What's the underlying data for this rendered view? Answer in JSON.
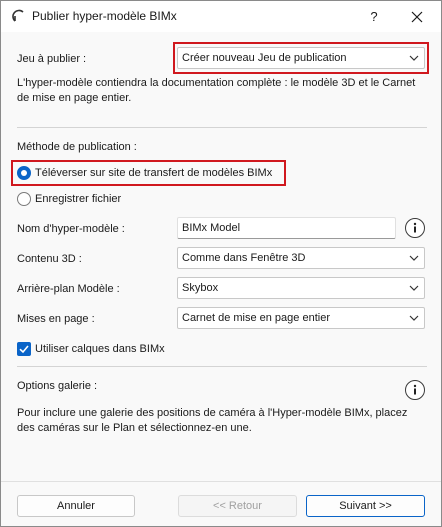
{
  "window": {
    "title": "Publier hyper-modèle BIMx",
    "help_label": "?",
    "close_label": "✕"
  },
  "publish_set": {
    "label": "Jeu à publier :",
    "value": "Créer nouveau Jeu de publication",
    "description": "L'hyper-modèle contiendra la documentation complète : le modèle 3D et le Carnet de mise en page entier."
  },
  "method": {
    "label": "Méthode de publication :",
    "options": [
      {
        "label": "Téléverser sur site de transfert de modèles BIMx",
        "selected": true
      },
      {
        "label": "Enregistrer fichier",
        "selected": false
      }
    ]
  },
  "fields": {
    "model_name_label": "Nom d'hyper-modèle :",
    "model_name_value": "BIMx Model",
    "content3d_label": "Contenu 3D :",
    "content3d_value": "Comme dans Fenêtre 3D",
    "background_label": "Arrière-plan Modèle :",
    "background_value": "Skybox",
    "layouts_label": "Mises en page :",
    "layouts_value": "Carnet de mise en page entier",
    "layers_checkbox_label": "Utiliser calques dans BIMx",
    "layers_checked": true
  },
  "gallery": {
    "label": "Options galerie :",
    "description": "Pour inclure une galerie des positions de caméra à l'Hyper-modèle BIMx, placez des caméras sur le Plan et sélectionnez-en une."
  },
  "footer": {
    "cancel": "Annuler",
    "back": "<< Retour",
    "next": "Suivant >>"
  },
  "colors": {
    "accent": "#0a64c8",
    "highlight": "#d0181e"
  }
}
